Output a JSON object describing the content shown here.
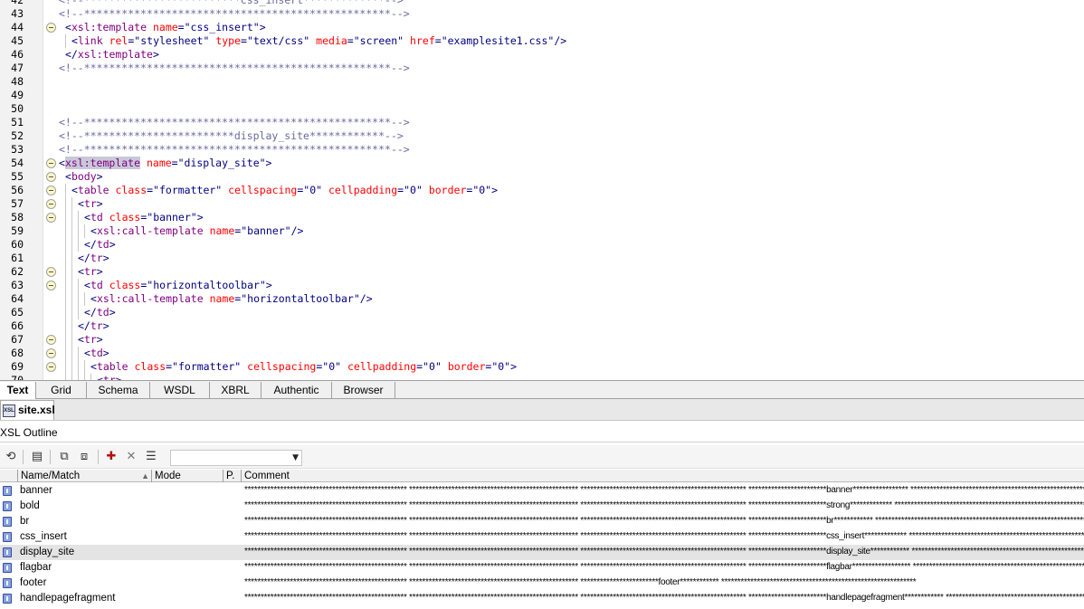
{
  "editor": {
    "lines": [
      {
        "num": "42",
        "indent": 0,
        "fold": false,
        "text": "<!--*************************css_insert*************-->"
      },
      {
        "num": "43",
        "indent": 0,
        "fold": false,
        "text": "<!--*************************************************-->"
      },
      {
        "num": "44",
        "indent": 1,
        "fold": true,
        "text": "<xsl:template name=\"css_insert\">"
      },
      {
        "num": "45",
        "indent": 2,
        "fold": false,
        "text": "<link rel=\"stylesheet\" type=\"text/css\" media=\"screen\" href=\"examplesite1.css\"/>"
      },
      {
        "num": "46",
        "indent": 1,
        "fold": false,
        "text": "</xsl:template>"
      },
      {
        "num": "47",
        "indent": 0,
        "fold": false,
        "text": "<!--*************************************************-->"
      },
      {
        "num": "48",
        "indent": 0,
        "fold": false,
        "text": ""
      },
      {
        "num": "49",
        "indent": 0,
        "fold": false,
        "text": ""
      },
      {
        "num": "50",
        "indent": 0,
        "fold": false,
        "text": ""
      },
      {
        "num": "51",
        "indent": 0,
        "fold": false,
        "text": "<!--*************************************************-->"
      },
      {
        "num": "52",
        "indent": 0,
        "fold": false,
        "text": "<!--************************display_site************-->"
      },
      {
        "num": "53",
        "indent": 0,
        "fold": false,
        "text": "<!--*************************************************-->"
      },
      {
        "num": "54",
        "indent": 0,
        "fold": true,
        "text": "<xsl:template name=\"display_site\">"
      },
      {
        "num": "55",
        "indent": 1,
        "fold": true,
        "text": "<body>"
      },
      {
        "num": "56",
        "indent": 2,
        "fold": true,
        "text": "<table class=\"formatter\" cellspacing=\"0\" cellpadding=\"0\" border=\"0\">"
      },
      {
        "num": "57",
        "indent": 3,
        "fold": true,
        "text": "<tr>"
      },
      {
        "num": "58",
        "indent": 4,
        "fold": true,
        "text": "<td class=\"banner\">"
      },
      {
        "num": "59",
        "indent": 5,
        "fold": false,
        "text": "<xsl:call-template name=\"banner\"/>"
      },
      {
        "num": "60",
        "indent": 4,
        "fold": false,
        "text": "</td>"
      },
      {
        "num": "61",
        "indent": 3,
        "fold": false,
        "text": "</tr>"
      },
      {
        "num": "62",
        "indent": 3,
        "fold": true,
        "text": "<tr>"
      },
      {
        "num": "63",
        "indent": 4,
        "fold": true,
        "text": "<td class=\"horizontaltoolbar\">"
      },
      {
        "num": "64",
        "indent": 5,
        "fold": false,
        "text": "<xsl:call-template name=\"horizontaltoolbar\"/>"
      },
      {
        "num": "65",
        "indent": 4,
        "fold": false,
        "text": "</td>"
      },
      {
        "num": "66",
        "indent": 3,
        "fold": false,
        "text": "</tr>"
      },
      {
        "num": "67",
        "indent": 3,
        "fold": true,
        "text": "<tr>"
      },
      {
        "num": "68",
        "indent": 4,
        "fold": true,
        "text": "<td>"
      },
      {
        "num": "69",
        "indent": 5,
        "fold": true,
        "text": "<table class=\"formatter\" cellspacing=\"0\" cellpadding=\"0\" border=\"0\">"
      },
      {
        "num": "70",
        "indent": 6,
        "fold": false,
        "text": "<tr>"
      }
    ]
  },
  "view_tabs": [
    "Text",
    "Grid",
    "Schema",
    "WSDL",
    "XBRL",
    "Authentic",
    "Browser"
  ],
  "active_view_tab": "Text",
  "document_tab": {
    "label": "site.xsl",
    "icon_text": "XSL"
  },
  "outline": {
    "title": "XSL Outline",
    "toolbar_icons": [
      "sync-icon",
      "xslt-template-icon",
      "expand-icon",
      "collapse-icon",
      "red-template-icon",
      "delete-icon",
      "list-icon"
    ],
    "filter_value": "",
    "columns": {
      "name": "Name/Match",
      "mode": "Mode",
      "priority": "P.",
      "comment": "Comment"
    },
    "sort_indicator": "▲",
    "rows": [
      {
        "name": "banner",
        "selected": false,
        "comment": "************************************************** **************************************************** *************************************************** ************************banner***************** ******************************************************************"
      },
      {
        "name": "bold",
        "selected": false,
        "comment": "************************************************** **************************************************** *************************************************** ************************strong************* *************************************************************************"
      },
      {
        "name": "br",
        "selected": false,
        "comment": "************************************************** **************************************************** *************************************************** ************************br************ **************************************************************************"
      },
      {
        "name": "css_insert",
        "selected": false,
        "comment": "************************************************** **************************************************** *************************************************** ************************css_insert************* *************************************************************************"
      },
      {
        "name": "display_site",
        "selected": true,
        "comment": "************************************************** **************************************************** *************************************************** ************************display_site************ ************************************************************************"
      },
      {
        "name": "flagbar",
        "selected": false,
        "comment": "************************************************** **************************************************** *************************************************** ************************flagbar****************** ****************************************************************"
      },
      {
        "name": "footer",
        "selected": false,
        "comment": "************************************************** **************************************************** ************************footer************ ************************************************************"
      },
      {
        "name": "handlepagefragment",
        "selected": false,
        "comment": "************************************************** **************************************************** *************************************************** ************************handlepagefragment************ *****************************************************"
      }
    ]
  }
}
